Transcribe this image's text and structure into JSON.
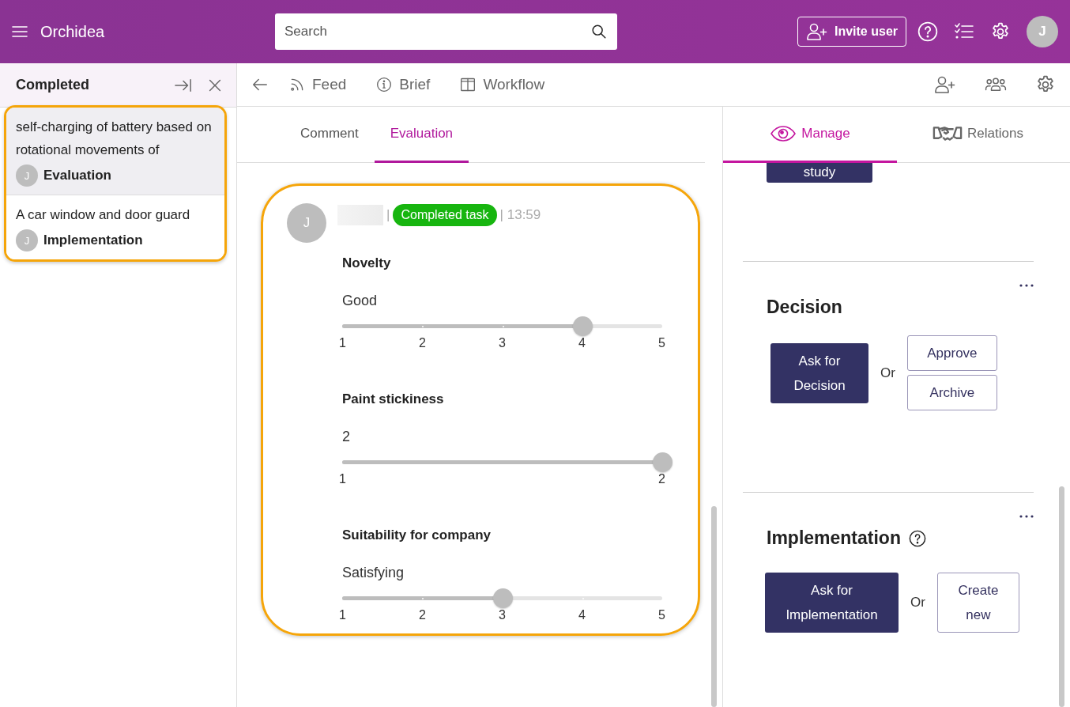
{
  "app": {
    "title": "Orchidea",
    "search": {
      "placeholder": "Search"
    },
    "invite_button": "Invite user",
    "avatar": "J"
  },
  "sidebar": {
    "title": "Completed",
    "highlighted": true,
    "items": [
      {
        "title": "self-charging of battery based on rotational movements of",
        "avatar": "J",
        "stage": "Evaluation",
        "selected": true
      },
      {
        "title": "A car window and door guard",
        "avatar": "J",
        "stage": "Implementation",
        "selected": false
      }
    ]
  },
  "nav": {
    "tabs": [
      {
        "label": "Feed",
        "kind": "feed"
      },
      {
        "label": "Brief",
        "kind": "brief"
      },
      {
        "label": "Workflow",
        "kind": "workflow"
      }
    ]
  },
  "feed": {
    "tabs": [
      {
        "label": "Comment",
        "selected": false
      },
      {
        "label": "Evaluation",
        "selected": true
      }
    ],
    "post": {
      "highlighted": true,
      "avatar": "J",
      "separator": "|",
      "badge": "Completed task",
      "time": "| 13:59",
      "criteria": [
        {
          "title": "Novelty",
          "value": "Good",
          "level": 0.75,
          "ticks": [
            "1",
            "2",
            "3",
            "4",
            "5"
          ]
        },
        {
          "title": "Paint stickiness",
          "value": "2",
          "level": 1,
          "ticks": [
            "1",
            "2"
          ]
        },
        {
          "title": "Suitability for company",
          "value": "Satisfying",
          "level": 0.5,
          "ticks": [
            "1",
            "2",
            "3",
            "4",
            "5"
          ]
        }
      ]
    }
  },
  "manage": {
    "tabs": [
      {
        "label": "Manage",
        "kind": "manage",
        "selected": true
      },
      {
        "label": "Relations",
        "kind": "relations",
        "selected": false
      }
    ],
    "partial_button": "study",
    "sections": [
      {
        "kind": "decision",
        "title": "Decision",
        "help": false,
        "primary": "Ask for Decision",
        "or": "Or",
        "options": [
          "Approve",
          "Archive"
        ]
      },
      {
        "kind": "implementation",
        "title": "Implementation",
        "help": true,
        "primary": "Ask for Implementation",
        "or": "Or",
        "options": [
          "Create new"
        ]
      }
    ]
  }
}
